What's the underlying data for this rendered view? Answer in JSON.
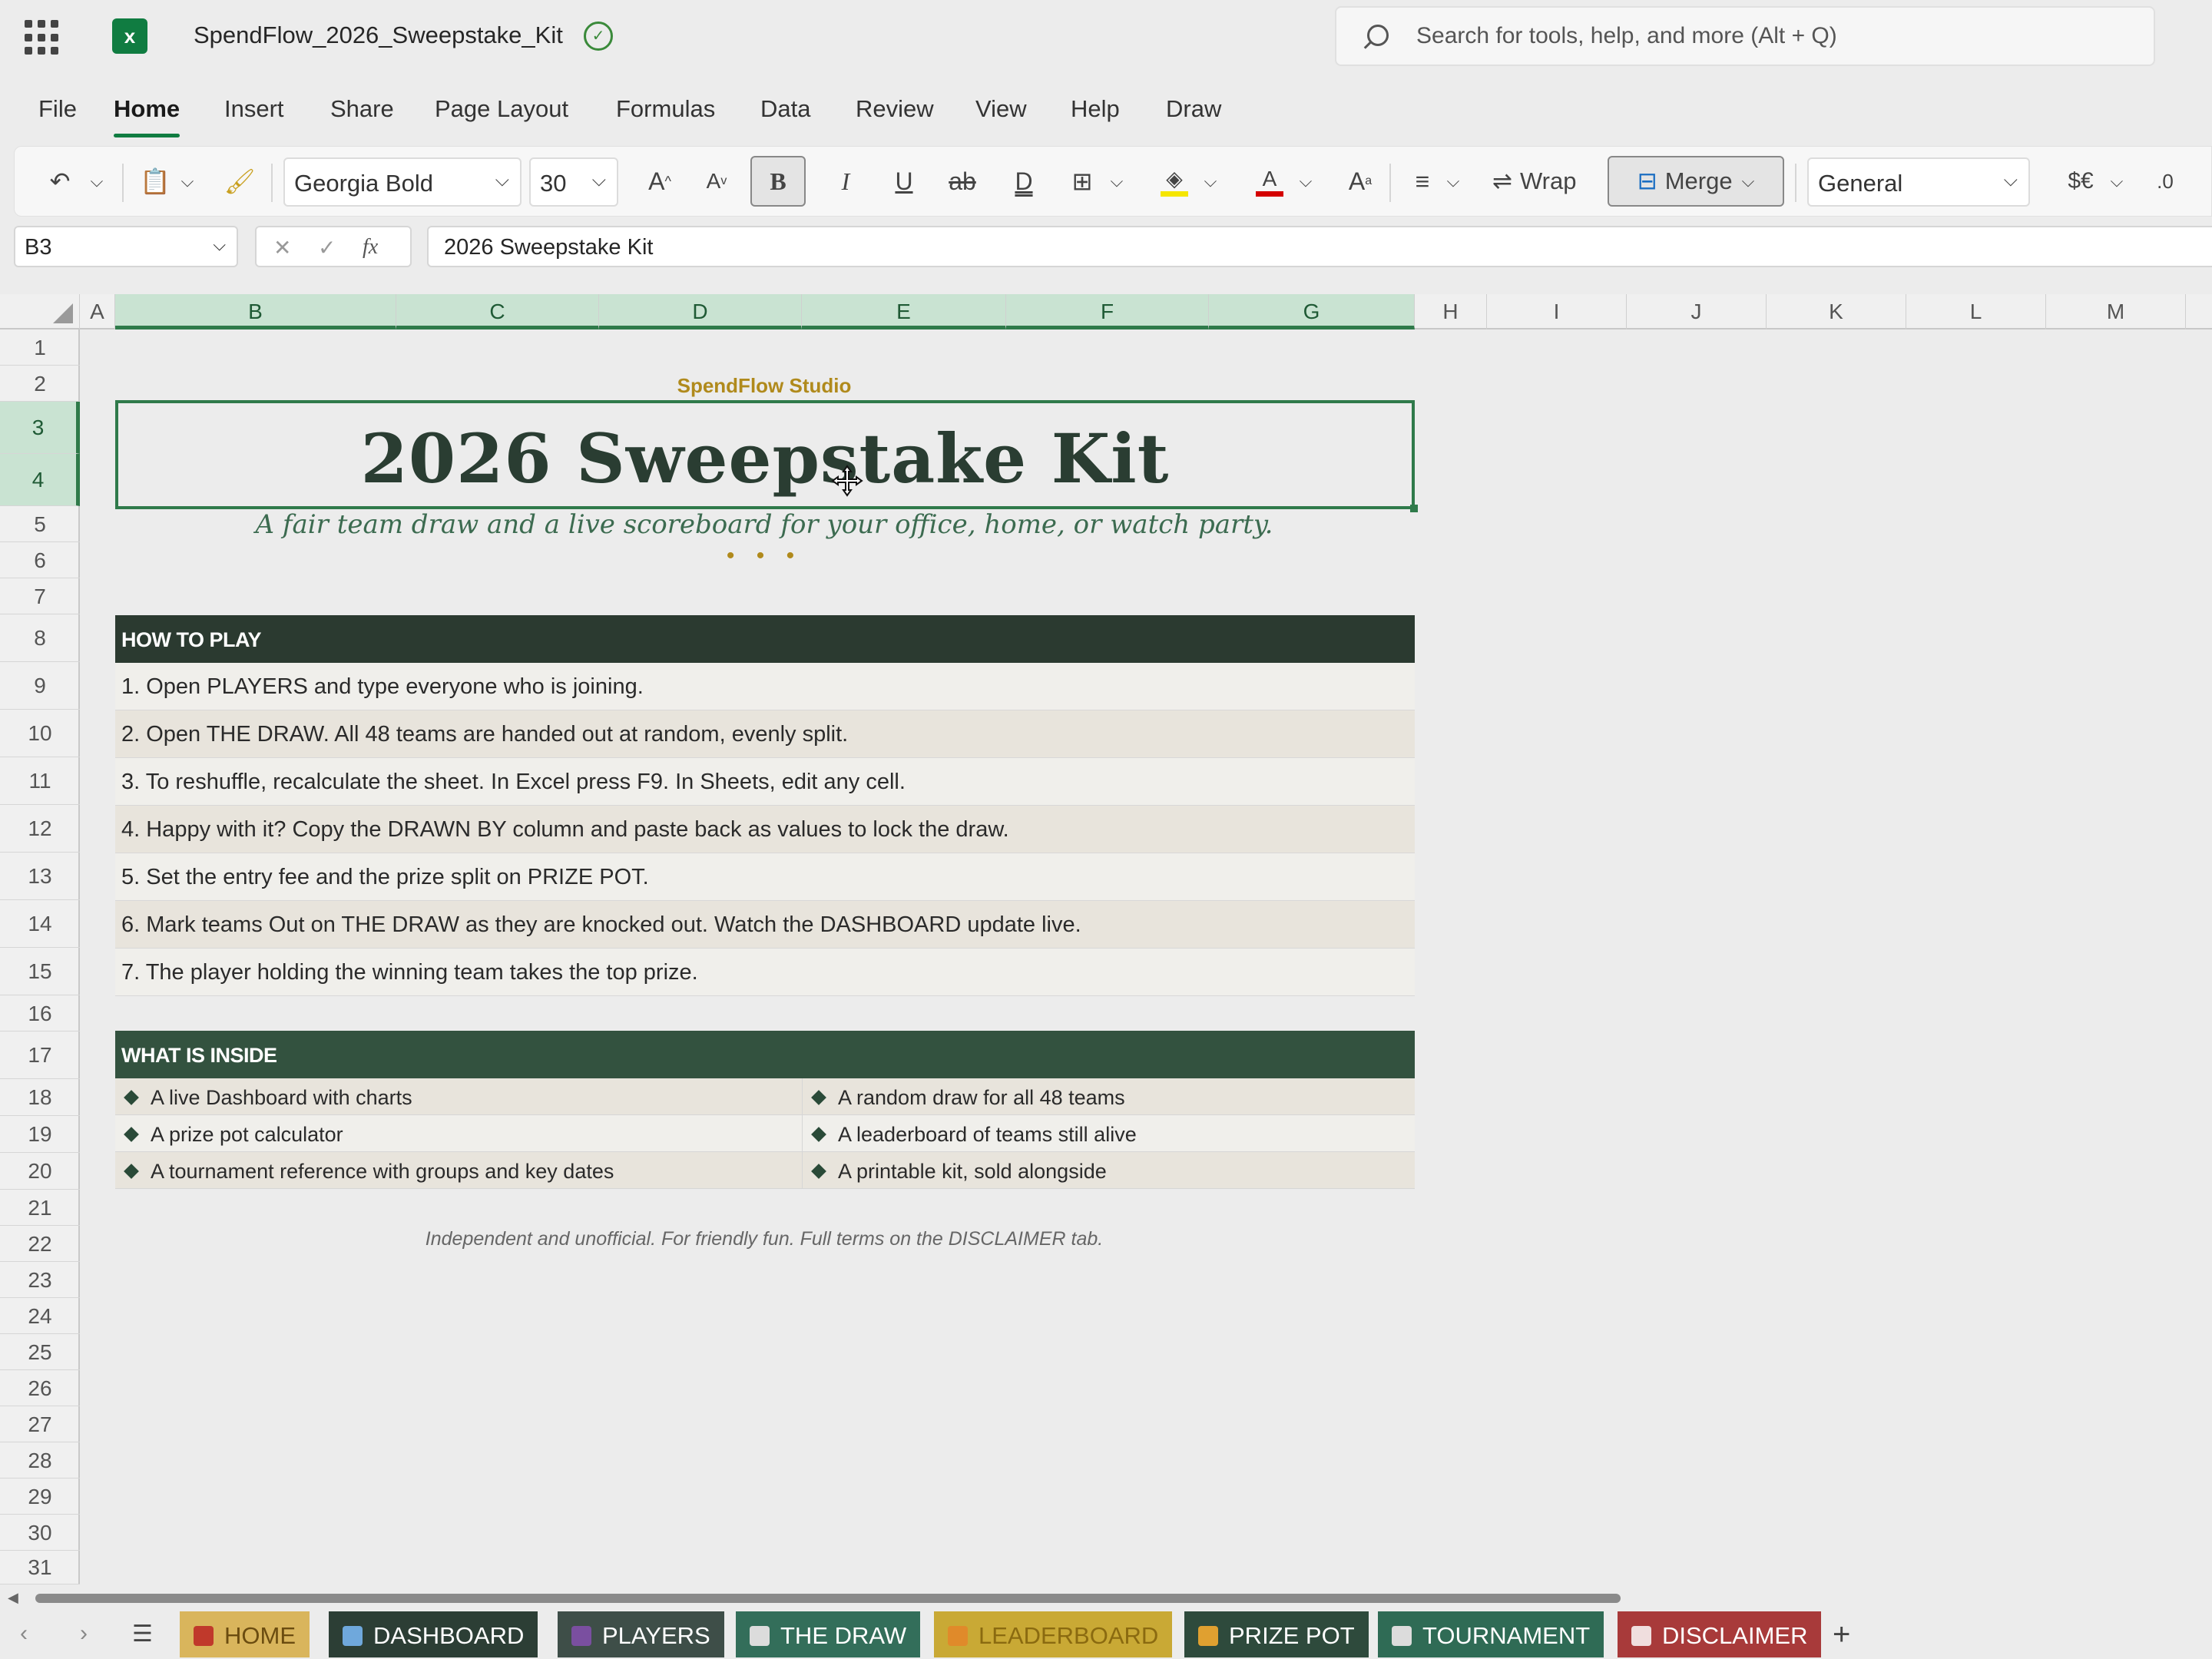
{
  "app": {
    "doc_title": "SpendFlow_2026_Sweepstake_Kit",
    "search_placeholder": "Search for tools, help, and more (Alt + Q)"
  },
  "menu": [
    "File",
    "Home",
    "Insert",
    "Share",
    "Page Layout",
    "Formulas",
    "Data",
    "Review",
    "View",
    "Help",
    "Draw"
  ],
  "menu_active": "Home",
  "ribbon": {
    "font_name": "Georgia Bold",
    "font_size": "30",
    "wrap_label": "Wrap",
    "merge_label": "Merge",
    "number_format": "General",
    "currency_label": "$€",
    "fill_color": "#f5e600",
    "font_color": "#d40000"
  },
  "formula_bar": {
    "name_box": "B3",
    "fx": "fx",
    "value": "2026 Sweepstake Kit"
  },
  "columns": [
    "A",
    "B",
    "C",
    "D",
    "E",
    "F",
    "G",
    "H",
    "I",
    "J",
    "K",
    "L",
    "M"
  ],
  "rows": [
    "1",
    "2",
    "3",
    "4",
    "5",
    "6",
    "7",
    "8",
    "9",
    "10",
    "11",
    "12",
    "13",
    "14",
    "15",
    "16",
    "17",
    "18",
    "19",
    "20",
    "21",
    "22",
    "23",
    "24",
    "25",
    "26",
    "27",
    "28",
    "29",
    "30",
    "31"
  ],
  "sheet": {
    "studio": "SpendFlow Studio",
    "title": "2026 Sweepstake Kit",
    "subtitle": "A fair team draw and a live scoreboard for your office, home, or watch party.",
    "dots": "• • •",
    "how_to_play_header": "HOW TO PLAY",
    "steps": [
      "1.  Open PLAYERS and type everyone who is joining.",
      "2.  Open THE DRAW. All 48 teams are handed out at random, evenly split.",
      "3.  To reshuffle, recalculate the sheet. In Excel press F9. In Sheets, edit any cell.",
      "4.  Happy with it? Copy the DRAWN BY column and paste back as values to lock the draw.",
      "5.  Set the entry fee and the prize split on PRIZE POT.",
      "6.  Mark teams Out on THE DRAW as they are knocked out. Watch the DASHBOARD update live.",
      "7.  The player holding the winning team takes the top prize."
    ],
    "what_inside_header": "WHAT IS INSIDE",
    "inside_left": [
      "A live Dashboard with charts",
      "A prize pot calculator",
      "A tournament reference with groups and key dates"
    ],
    "inside_right": [
      "A random draw for all 48 teams",
      "A leaderboard of teams still alive",
      "A printable kit, sold alongside"
    ],
    "disclaimer": "Independent and unofficial. For friendly fun. Full terms on the DISCLAIMER tab.",
    "colors": {
      "header_dark": "#2b3a30",
      "header_green": "#33523f",
      "accent_gold": "#b08a1c",
      "title_color": "#2a3d32"
    }
  },
  "tabs": [
    {
      "label": "HOME",
      "bg": "#d9b55c",
      "fg": "#6b4c10",
      "icon": "home-icon",
      "icon_color": "#c0392b"
    },
    {
      "label": "DASHBOARD",
      "bg": "#2c3e35",
      "fg": "#ffffff",
      "icon": "chart-icon",
      "icon_color": "#6fa8dc"
    },
    {
      "label": "PLAYERS",
      "bg": "#3e4e48",
      "fg": "#ffffff",
      "icon": "people-icon",
      "icon_color": "#7a4fa0"
    },
    {
      "label": "THE DRAW",
      "bg": "#336e5a",
      "fg": "#ffffff",
      "icon": "dice-icon",
      "icon_color": "#dcdcdc"
    },
    {
      "label": "LEADERBOARD",
      "bg": "#c9a935",
      "fg": "#8a6a10",
      "icon": "medal-icon",
      "icon_color": "#e08a2a"
    },
    {
      "label": "PRIZE POT",
      "bg": "#2e4a3c",
      "fg": "#ffffff",
      "icon": "moneybag-icon",
      "icon_color": "#e0a030"
    },
    {
      "label": "TOURNAMENT",
      "bg": "#2f6b55",
      "fg": "#ffffff",
      "icon": "calendar-icon",
      "icon_color": "#dcdcdc"
    },
    {
      "label": "DISCLAIMER",
      "bg": "#a83a3a",
      "fg": "#ffffff",
      "icon": "scales-icon",
      "icon_color": "#f0dede"
    }
  ]
}
